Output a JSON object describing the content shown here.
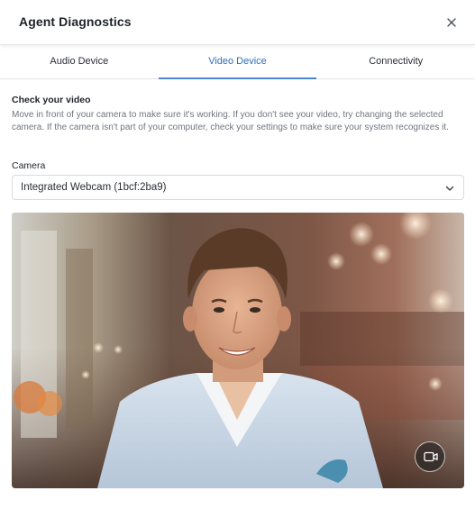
{
  "dialog": {
    "title": "Agent Diagnostics",
    "close_icon": "close-icon"
  },
  "tabs": [
    {
      "label": "Audio Device",
      "active": false
    },
    {
      "label": "Video Device",
      "active": true
    },
    {
      "label": "Connectivity",
      "active": false
    }
  ],
  "video": {
    "section_title": "Check your video",
    "description": "Move in front of your camera to make sure it's working. If you don't see your video, try changing the selected camera. If the camera isn't part of your computer, check your settings to make sure your system recognizes it.",
    "camera_label": "Camera",
    "camera_selected": "Integrated Webcam (1bcf:2ba9)",
    "chevron_icon": "chevron-down-icon",
    "camera_toggle_icon": "video-camera-icon"
  },
  "colors": {
    "accent": "#4b86d1",
    "active_tab_text": "#2f6fbf",
    "border": "#e4e5e8"
  }
}
